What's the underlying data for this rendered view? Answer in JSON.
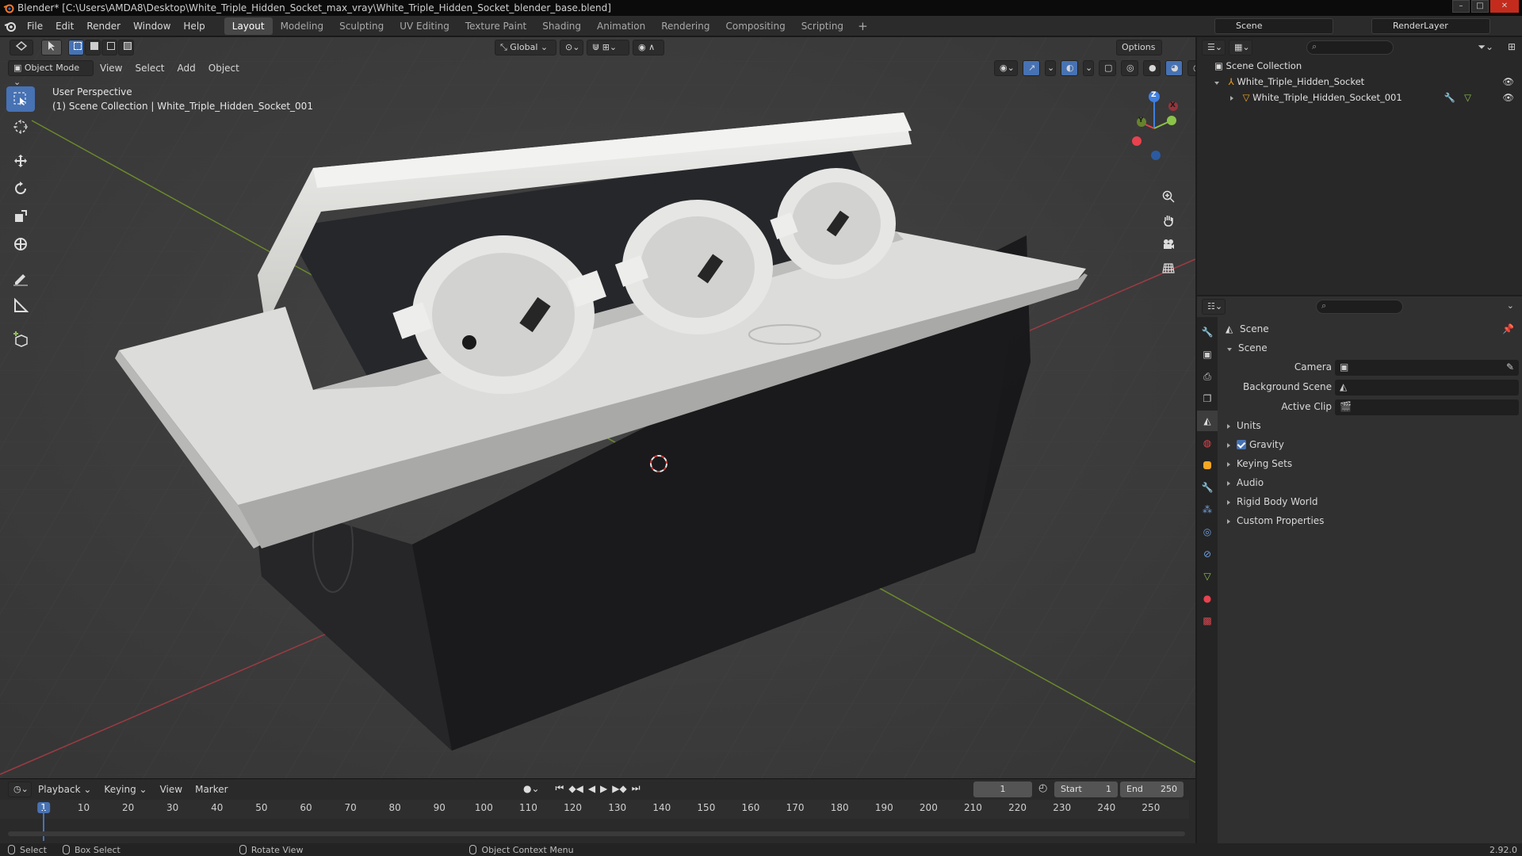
{
  "titlebar": {
    "title": "Blender* [C:\\Users\\AMDA8\\Desktop\\White_Triple_Hidden_Socket_max_vray\\White_Triple_Hidden_Socket_blender_base.blend]",
    "minimize": "–",
    "maximize": "□",
    "close": "✕"
  },
  "menu": {
    "file": "File",
    "edit": "Edit",
    "render": "Render",
    "window": "Window",
    "help": "Help"
  },
  "workspaces": [
    "Layout",
    "Modeling",
    "Sculpting",
    "UV Editing",
    "Texture Paint",
    "Shading",
    "Animation",
    "Rendering",
    "Compositing",
    "Scripting"
  ],
  "workspace_add": "+",
  "scene_selector": {
    "value": "Scene"
  },
  "viewlayer_selector": {
    "value": "RenderLayer"
  },
  "viewport": {
    "header": {
      "transform_orientation": "Global",
      "options": "Options"
    },
    "mode": "Object Mode",
    "menus": {
      "view": "View",
      "select": "Select",
      "add": "Add",
      "object": "Object"
    },
    "overlay": {
      "perspective": "User Perspective",
      "collection_info": "(1) Scene Collection | White_Triple_Hidden_Socket_001"
    },
    "gizmo": {
      "x": "X",
      "y": "Y",
      "z": "Z"
    }
  },
  "timeline": {
    "menus": {
      "playback": "Playback",
      "keying": "Keying",
      "view": "View",
      "marker": "Marker"
    },
    "current_frame": "1",
    "start_label": "Start",
    "start": "1",
    "end_label": "End",
    "end": "250",
    "ruler": [
      "1",
      "10",
      "20",
      "30",
      "40",
      "50",
      "60",
      "70",
      "80",
      "90",
      "100",
      "110",
      "120",
      "130",
      "140",
      "150",
      "160",
      "170",
      "180",
      "190",
      "200",
      "210",
      "220",
      "230",
      "240",
      "250"
    ]
  },
  "statusbar": {
    "select": "Select",
    "box_select": "Box Select",
    "rotate_view": "Rotate View",
    "context_menu": "Object Context Menu",
    "version": "2.92.0"
  },
  "outliner": {
    "scene_collection": "Scene Collection",
    "collection": "White_Triple_Hidden_Socket",
    "object": "White_Triple_Hidden_Socket_001"
  },
  "properties": {
    "context": "Scene",
    "panel_title": "Scene",
    "camera_label": "Camera",
    "background_scene_label": "Background Scene",
    "active_clip_label": "Active Clip",
    "sections": {
      "units": "Units",
      "gravity": "Gravity",
      "keying_sets": "Keying Sets",
      "audio": "Audio",
      "rigid_body_world": "Rigid Body World",
      "custom_properties": "Custom Properties"
    },
    "gravity_enabled": true
  },
  "colors": {
    "accent": "#4772b3",
    "axis_x": "#e8424e",
    "axis_y": "#8bc34a",
    "axis_z": "#3f7fe0",
    "viewport_bg": "#3d3d3d"
  }
}
